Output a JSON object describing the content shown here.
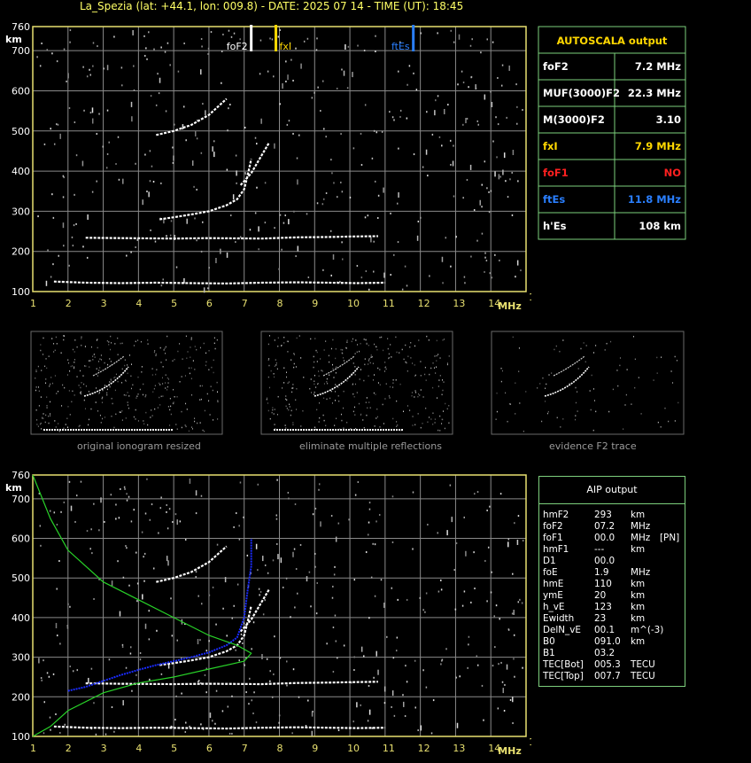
{
  "header": {
    "title": "La_Spezia (lat: +44.1, lon: 009.8) - DATE: 2025 07 14 - TIME (UT): 18:45"
  },
  "colors": {
    "axis": "#e8e070",
    "grid": "#8a8a8a",
    "box_border": "#7ccf7c",
    "yellow": "#ffd700",
    "blue": "#2a7fff",
    "red": "#ff2020",
    "trace": "#ffffff",
    "profile_blue": "#1a2cff",
    "model_green": "#28d228"
  },
  "chart_data": [
    {
      "type": "scatter",
      "title": "",
      "xlabel": "MHz",
      "ylabel": "km",
      "xlim": [
        1,
        15
      ],
      "ylim": [
        100,
        760
      ],
      "x_ticks": [
        "1",
        "2",
        "3",
        "4",
        "5",
        "6",
        "7",
        "8",
        "9",
        "10",
        "11",
        "12",
        "13",
        "14",
        "15"
      ],
      "y_ticks": [
        "100",
        "200",
        "300",
        "400",
        "500",
        "600",
        "700",
        "760"
      ],
      "markers": [
        {
          "label": "foF2",
          "x": 7.2,
          "color": "#ffffff"
        },
        {
          "label": "fxI",
          "x": 7.9,
          "color": "#ffd700"
        },
        {
          "label": "ftEs",
          "x": 11.8,
          "color": "#2a7fff"
        }
      ],
      "series": [
        {
          "name": "",
          "points": [
            [
              1.6,
              125
            ],
            [
              2.5,
              122
            ],
            [
              3.5,
              121
            ],
            [
              4.5,
              122
            ],
            [
              5.5,
              121
            ],
            [
              6.5,
              120
            ],
            [
              7.5,
              122
            ],
            [
              8.5,
              123
            ],
            [
              9.4,
              122
            ],
            [
              10.2,
              121
            ],
            [
              11.0,
              122
            ]
          ]
        },
        {
          "name": "",
          "points": [
            [
              2.5,
              234
            ],
            [
              3.5,
              233
            ],
            [
              5.0,
              232
            ],
            [
              6.0,
              233
            ],
            [
              7.5,
              232
            ],
            [
              8.5,
              235
            ],
            [
              9.5,
              236
            ],
            [
              10.0,
              237
            ],
            [
              10.8,
              238
            ]
          ]
        },
        {
          "name": "",
          "points": [
            [
              4.6,
              280
            ],
            [
              5.0,
              285
            ],
            [
              5.5,
              292
            ],
            [
              6.0,
              300
            ],
            [
              6.5,
              315
            ],
            [
              6.8,
              330
            ],
            [
              7.0,
              355
            ],
            [
              7.1,
              390
            ],
            [
              7.2,
              430
            ]
          ]
        },
        {
          "name": "",
          "points": [
            [
              4.5,
              490
            ],
            [
              5.0,
              500
            ],
            [
              5.5,
              515
            ],
            [
              6.0,
              540
            ],
            [
              6.5,
              580
            ]
          ]
        },
        {
          "name": "",
          "points": [
            [
              6.9,
              365
            ],
            [
              7.2,
              395
            ],
            [
              7.5,
              440
            ],
            [
              7.7,
              470
            ]
          ]
        }
      ]
    },
    {
      "type": "line",
      "title": "",
      "xlabel": "MHz",
      "ylabel": "km",
      "xlim": [
        1,
        15
      ],
      "ylim": [
        100,
        760
      ],
      "x_ticks": [
        "1",
        "2",
        "3",
        "4",
        "5",
        "6",
        "7",
        "8",
        "9",
        "10",
        "11",
        "12",
        "13",
        "14",
        "15"
      ],
      "y_ticks": [
        "100",
        "200",
        "300",
        "400",
        "500",
        "600",
        "700",
        "760"
      ],
      "series": [
        {
          "name": "",
          "points": [
            [
              1.6,
              125
            ],
            [
              2.5,
              122
            ],
            [
              3.5,
              121
            ],
            [
              4.5,
              122
            ],
            [
              5.5,
              121
            ],
            [
              6.5,
              120
            ],
            [
              7.5,
              122
            ],
            [
              8.5,
              123
            ],
            [
              9.4,
              122
            ],
            [
              10.2,
              121
            ],
            [
              11.0,
              122
            ]
          ]
        },
        {
          "name": "",
          "points": [
            [
              2.5,
              234
            ],
            [
              3.5,
              233
            ],
            [
              5.0,
              232
            ],
            [
              6.0,
              233
            ],
            [
              7.5,
              232
            ],
            [
              8.5,
              235
            ],
            [
              9.5,
              236
            ],
            [
              10.0,
              237
            ],
            [
              10.8,
              238
            ]
          ]
        },
        {
          "name": "",
          "points": [
            [
              4.6,
              280
            ],
            [
              5.0,
              285
            ],
            [
              5.5,
              292
            ],
            [
              6.0,
              300
            ],
            [
              6.5,
              315
            ],
            [
              6.8,
              330
            ],
            [
              7.0,
              355
            ],
            [
              7.1,
              390
            ],
            [
              7.2,
              430
            ]
          ]
        },
        {
          "name": "",
          "points": [
            [
              4.5,
              490
            ],
            [
              5.0,
              500
            ],
            [
              5.5,
              515
            ],
            [
              6.0,
              540
            ],
            [
              6.5,
              580
            ]
          ]
        },
        {
          "name": "",
          "points": [
            [
              6.9,
              365
            ],
            [
              7.2,
              395
            ],
            [
              7.5,
              440
            ],
            [
              7.7,
              470
            ]
          ]
        },
        {
          "name": "",
          "points": [
            [
              2.0,
              215
            ],
            [
              2.5,
              225
            ],
            [
              3.0,
              240
            ],
            [
              3.5,
              255
            ],
            [
              4.0,
              268
            ],
            [
              4.5,
              280
            ],
            [
              5.0,
              290
            ],
            [
              5.5,
              300
            ],
            [
              6.0,
              312
            ],
            [
              6.5,
              330
            ],
            [
              6.8,
              350
            ],
            [
              7.0,
              400
            ],
            [
              7.1,
              470
            ],
            [
              7.2,
              530
            ],
            [
              7.2,
              600
            ]
          ]
        },
        {
          "name": "",
          "points": [
            [
              1.0,
              760
            ],
            [
              1.5,
              650
            ],
            [
              2.0,
              570
            ],
            [
              3.0,
              490
            ],
            [
              4.0,
              445
            ],
            [
              5.0,
              400
            ],
            [
              6.0,
              355
            ],
            [
              6.8,
              330
            ],
            [
              7.2,
              310
            ],
            [
              7.0,
              290
            ],
            [
              6.0,
              270
            ],
            [
              5.0,
              250
            ],
            [
              4.0,
              235
            ],
            [
              3.0,
              210
            ],
            [
              2.0,
              165
            ],
            [
              1.5,
              125
            ],
            [
              1.0,
              100
            ]
          ]
        }
      ]
    }
  ],
  "autoscala": {
    "title": "AUTOSCALA output",
    "rows": [
      {
        "label": "foF2",
        "value": "7.2 MHz",
        "color": "#ffffff"
      },
      {
        "label": "MUF(3000)F2",
        "value": "22.3 MHz",
        "color": "#ffffff"
      },
      {
        "label": "M(3000)F2",
        "value": "3.10",
        "color": "#ffffff"
      },
      {
        "label": "fxI",
        "value": "7.9 MHz",
        "color": "#ffd700"
      },
      {
        "label": "foF1",
        "value": "NO",
        "color": "#ff2020"
      },
      {
        "label": "ftEs",
        "value": "11.8 MHz",
        "color": "#2a7fff"
      },
      {
        "label": "h'Es",
        "value": "108     km",
        "color": "#ffffff"
      }
    ]
  },
  "thumbnails": [
    {
      "caption": "original ionogram resized"
    },
    {
      "caption": "eliminate multiple reflections"
    },
    {
      "caption": "evidence F2 trace"
    }
  ],
  "aip": {
    "title": "AIP output",
    "rows": [
      {
        "name": "hmF2",
        "value": "293",
        "unit": "km",
        "extra": ""
      },
      {
        "name": "foF2",
        "value": "07.2",
        "unit": "MHz",
        "extra": ""
      },
      {
        "name": "foF1",
        "value": "00.0",
        "unit": "MHz",
        "extra": "[PN]"
      },
      {
        "name": "hmF1",
        "value": "---",
        "unit": "km",
        "extra": ""
      },
      {
        "name": "D1",
        "value": "00.0",
        "unit": "",
        "extra": ""
      },
      {
        "name": "foE",
        "value": "1.9",
        "unit": "MHz",
        "extra": ""
      },
      {
        "name": "hmE",
        "value": "110",
        "unit": "km",
        "extra": ""
      },
      {
        "name": "ymE",
        "value": "20",
        "unit": "km",
        "extra": ""
      },
      {
        "name": "h_vE",
        "value": "123",
        "unit": "km",
        "extra": ""
      },
      {
        "name": "Ewidth",
        "value": "23",
        "unit": "km",
        "extra": ""
      },
      {
        "name": "DelN_vE",
        "value": "00.1",
        "unit": "m^(-3)",
        "extra": ""
      },
      {
        "name": "B0",
        "value": "091.0",
        "unit": "km",
        "extra": ""
      },
      {
        "name": "B1",
        "value": "03.2",
        "unit": "",
        "extra": ""
      },
      {
        "name": "TEC[Bot]",
        "value": "005.3",
        "unit": "TECU",
        "extra": ""
      },
      {
        "name": "TEC[Top]",
        "value": "007.7",
        "unit": "TECU",
        "extra": ""
      }
    ]
  }
}
